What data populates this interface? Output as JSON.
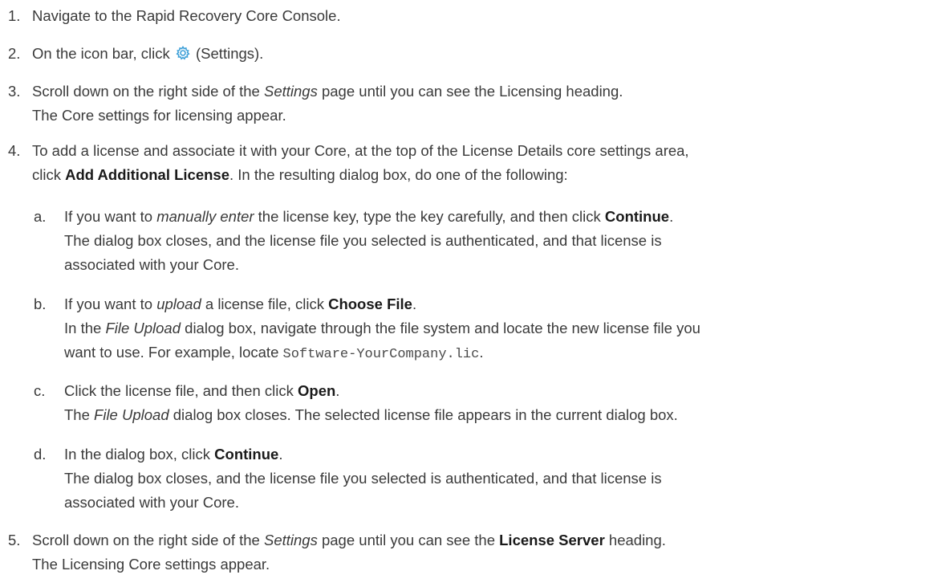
{
  "steps": {
    "s1": {
      "num": "1.",
      "text": "Navigate to the Rapid Recovery Core Console."
    },
    "s2": {
      "num": "2.",
      "pre": "On the icon bar, click",
      "post": "(Settings).",
      "icon": "gear-icon",
      "icon_color": "#3ea0d8"
    },
    "s3": {
      "num": "3.",
      "t1": "Scroll down on the right side of the",
      "i1": "Settings",
      "t2": "page until you can see the Licensing heading.",
      "line2": "The Core settings for licensing appear."
    },
    "s4": {
      "num": "4.",
      "t1": "To add a license and associate it with your Core, at the top of the License Details core settings area,",
      "t2": "click",
      "b1": "Add Additional License",
      "t3": ". In the resulting dialog box, do one of the following:"
    },
    "sa": {
      "letter": "a.",
      "t1": "If you want to",
      "i1": "manually enter",
      "t2": "the license key, type the key carefully, and then click",
      "b1": "Continue",
      "t3": ".",
      "line2": "The dialog box closes, and the license file you selected is authenticated, and that license is",
      "line3": "associated with your Core."
    },
    "sb": {
      "letter": "b.",
      "t1": "If you want to",
      "i1": "upload",
      "t2": "a license file, click",
      "b1": "Choose File",
      "t3": ".",
      "l2a": "In the",
      "l2i": "File Upload",
      "l2b": "dialog box, navigate through the file system and locate the new license file you",
      "l3a": "want to use. For example, locate",
      "l3code": "Software-YourCompany.lic",
      "l3b": "."
    },
    "sc": {
      "letter": "c.",
      "t1": "Click the license file, and then click",
      "b1": "Open",
      "t2": ".",
      "l2a": "The",
      "l2i": "File Upload",
      "l2b": "dialog box closes. The selected license file appears in the current dialog box."
    },
    "sd": {
      "letter": "d.",
      "t1": "In the dialog box, click",
      "b1": "Continue",
      "t2": ".",
      "line2": "The dialog box closes, and the license file you selected is authenticated, and that license is",
      "line3": "associated with your Core."
    },
    "s5": {
      "num": "5.",
      "t1": "Scroll down on the right side of the",
      "i1": "Settings",
      "t2": "page until you can see the",
      "b1": "License Server",
      "t3": "heading.",
      "line2": "The Licensing Core settings appear."
    }
  }
}
